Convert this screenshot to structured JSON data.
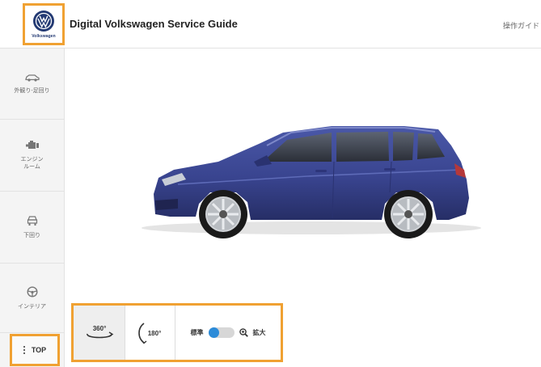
{
  "header": {
    "title": "Digital Volkswagen Service Guide",
    "guide_link": "操作ガイド",
    "logo_text": "Volkswagen"
  },
  "sidebar": {
    "items": [
      {
        "label": "外観り-足回り",
        "icon": "car-exterior-icon"
      },
      {
        "label": "エンジン\nルーム",
        "icon": "engine-icon"
      },
      {
        "label": "下回り",
        "icon": "car-underbody-icon"
      },
      {
        "label": "インテリア",
        "icon": "steering-wheel-icon"
      }
    ],
    "top_label": "TOP"
  },
  "controls": {
    "rotate_360_label": "360°",
    "rotate_180_label": "180°",
    "zoom_standard_label": "標準",
    "zoom_enlarge_label": "拡大",
    "zoom_enlarged": false
  },
  "colors": {
    "accent_highlight": "#f0a132",
    "brand_blue": "#233a73",
    "toggle_blue": "#2c8bd8",
    "car_body": "#3a4591"
  }
}
